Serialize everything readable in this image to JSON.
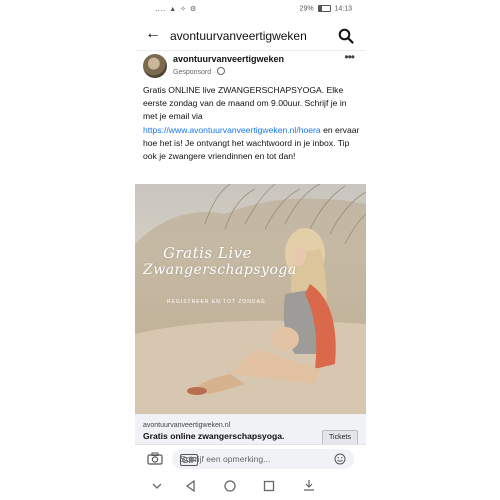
{
  "status": {
    "icons": "‥‥ ▲ ✧ ⚙",
    "battery": "29%",
    "time": "14:13"
  },
  "header": {
    "title": "avontuurvanveertigweken"
  },
  "post": {
    "page_name": "avontuurvanveertigweken",
    "sponsored": "Gesponsord ·",
    "more": "•••",
    "text_1": "Gratis ONLINE live ZWANGERSCHAPSYOGA. Elke eerste zondag van de maand om 9.00uur. Schrijf je in met je email via ",
    "link": "https://www.avontuurvanveertigweken.nl/hoera",
    "text_2": " en ervaar hoe het is! Je ontvangt het wachtwoord in je inbox. Tip ook je zwangere vriendinnen en tot dan!"
  },
  "image": {
    "line1": "Gratis Live",
    "line2": "Zwangerschapsyoga",
    "line3": "REGISTREER EN TOT ZONDAG"
  },
  "link_preview": {
    "domain": "avontuurvanveertigweken.nl",
    "title": "Gratis online zwangerschapsyoga.",
    "cta": "Tickets"
  },
  "comment": {
    "placeholder": "Schrijf een opmerking...",
    "gif": "GIF"
  },
  "colors": {
    "link": "#1877f2",
    "text": "#111111",
    "muted": "#65676b"
  }
}
